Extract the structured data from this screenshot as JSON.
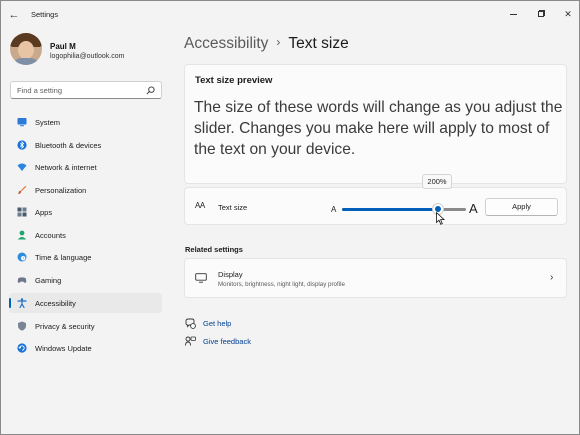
{
  "window": {
    "title": "Settings"
  },
  "profile": {
    "name": "Paul M",
    "email": "logophilia@outlook.com"
  },
  "search": {
    "placeholder": "Find a setting"
  },
  "sidebar": {
    "items": [
      {
        "label": "System",
        "icon": "system-icon"
      },
      {
        "label": "Bluetooth & devices",
        "icon": "bluetooth-icon"
      },
      {
        "label": "Network & internet",
        "icon": "wifi-icon"
      },
      {
        "label": "Personalization",
        "icon": "brush-icon"
      },
      {
        "label": "Apps",
        "icon": "apps-icon"
      },
      {
        "label": "Accounts",
        "icon": "accounts-icon"
      },
      {
        "label": "Time & language",
        "icon": "globe-clock-icon"
      },
      {
        "label": "Gaming",
        "icon": "gamepad-icon"
      },
      {
        "label": "Accessibility",
        "icon": "accessibility-icon",
        "active": true
      },
      {
        "label": "Privacy & security",
        "icon": "shield-icon"
      },
      {
        "label": "Windows Update",
        "icon": "update-icon"
      }
    ]
  },
  "breadcrumb": {
    "parent": "Accessibility",
    "separator": "›",
    "current": "Text size"
  },
  "preview": {
    "title": "Text size preview",
    "text": "The size of these words will change as you adjust the slider. Changes you make here will apply to most of the text on your device."
  },
  "text_size": {
    "icon_text": "AA",
    "label": "Text size",
    "small_marker": "A",
    "large_marker": "A",
    "value_label": "200%",
    "value_fraction": 0.775,
    "apply_label": "Apply"
  },
  "related": {
    "heading": "Related settings",
    "display_title": "Display",
    "display_subtitle": "Monitors, brightness, night light, display profile"
  },
  "links": {
    "help": "Get help",
    "feedback": "Give feedback"
  },
  "colors": {
    "accent": "#005fb8",
    "link": "#003e92"
  }
}
